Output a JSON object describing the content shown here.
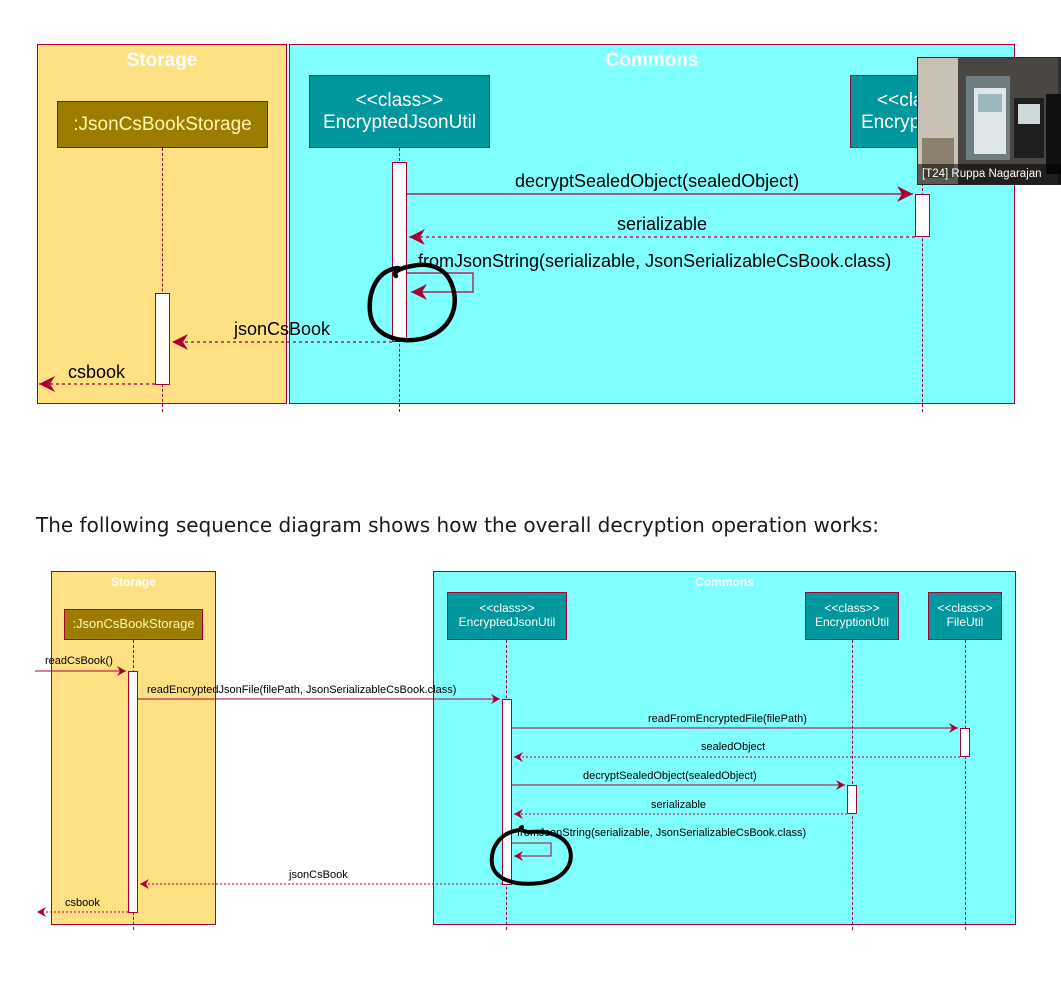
{
  "diagram_top": {
    "storage_title": "Storage",
    "commons_title": "Commons",
    "json_storage": ":JsonCsBookStorage",
    "encrypted_util_line1": "<<class>>",
    "encrypted_util_line2": "EncryptedJsonUtil",
    "encryption_util_line1": "<<cla",
    "encryption_util_line2": "Encryp",
    "msg_decrypt": "decryptSealedObject(sealedObject)",
    "msg_serializable": "serializable",
    "msg_from_json": "fromJsonString(serializable, JsonSerializableCsBook.class)",
    "msg_json_cs_book": "jsonCsBook",
    "msg_csbook": "csbook"
  },
  "video": {
    "participant_name": "[T24] Ruppa Nagarajan"
  },
  "paragraph": "The following sequence diagram shows how the overall decryption operation works:",
  "diagram_bottom": {
    "storage_title": "Storage",
    "commons_title": "Commons",
    "json_storage": ":JsonCsBookStorage",
    "encrypted_util_line1": "<<class>>",
    "encrypted_util_line2": "EncryptedJsonUtil",
    "encryption_util_line1": "<<class>>",
    "encryption_util_line2": "EncryptionUtil",
    "file_util_line1": "<<class>>",
    "file_util_line2": "FileUtil",
    "msg_read_cs_book": "readCsBook()",
    "msg_read_encrypted": "readEncryptedJsonFile(filePath, JsonSerializableCsBook.class)",
    "msg_read_from_encrypted": "readFromEncryptedFile(filePath)",
    "msg_sealed_object": "sealedObject",
    "msg_decrypt": "decryptSealedObject(sealedObject)",
    "msg_serializable": "serializable",
    "msg_from_json": "fromJsonString(serializable, JsonSerializableCsBook.class)",
    "msg_json_cs_book": "jsonCsBook",
    "msg_csbook": "csbook"
  },
  "colors": {
    "storage_bg": "#ffe082",
    "commons_bg": "#80ffff",
    "border": "#a80036",
    "olive": "#9c7d00",
    "teal": "#00979d"
  }
}
